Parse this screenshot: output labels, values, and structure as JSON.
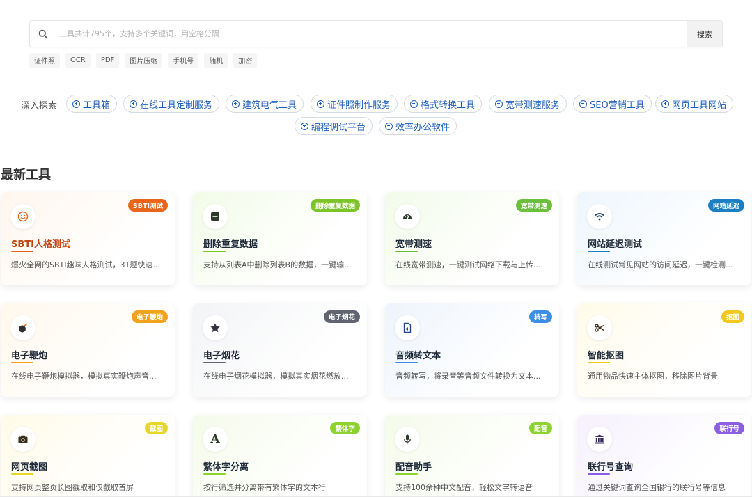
{
  "search": {
    "placeholder": "工具共计795个，支持多个关键词，用空格分隔",
    "button_label": "搜索"
  },
  "tags": [
    "证件照",
    "OCR",
    "PDF",
    "图片压缩",
    "手机号",
    "随机",
    "加密"
  ],
  "explore": {
    "label": "深入探索",
    "chips": [
      "工具箱",
      "在线工具定制服务",
      "建筑电气工具",
      "证件照制作服务",
      "格式转换工具",
      "宽带测速服务",
      "SEO营销工具",
      "网页工具网站",
      "编程调试平台",
      "效率办公软件"
    ]
  },
  "section_title": "最新工具",
  "cards": [
    {
      "title": "SBTI人格测试",
      "badge": "SBTI测试",
      "desc": "爆火全网的SBTI趣味人格测试，31题快速...",
      "icon": "smile-icon",
      "accent": "#e8661c",
      "bg": "#fff6ee"
    },
    {
      "title": "删除重复数据",
      "badge": "删除重复数据",
      "desc": "支持从列表A中删除列表B的数据，一键输...",
      "icon": "minus-square-icon",
      "accent": "#7cc428",
      "bg": "#f3fbe8"
    },
    {
      "title": "宽带测速",
      "badge": "宽带测速",
      "desc": "在线宽带测速，一键测试网络下载与上传...",
      "icon": "speedometer-icon",
      "accent": "#6cbf3a",
      "bg": "#f3fbea"
    },
    {
      "title": "网站延迟测试",
      "badge": "网站延迟",
      "desc": "在线测试常见网站的访问延迟，一键检测...",
      "icon": "wifi-icon",
      "accent": "#1b7fc4",
      "bg": "#eef6fd"
    },
    {
      "title": "电子鞭炮",
      "badge": "电子鞭炮",
      "desc": "在线电子鞭炮模拟器，模拟真实鞭炮声音...",
      "icon": "bomb-icon",
      "accent": "#f2a21c",
      "bg": "#fff8ec"
    },
    {
      "title": "电子烟花",
      "badge": "电子烟花",
      "desc": "在线电子烟花模拟器，模拟真实烟花燃放...",
      "icon": "star-icon",
      "accent": "#5f6470",
      "bg": "#f3f4f6"
    },
    {
      "title": "音频转文本",
      "badge": "转写",
      "desc": "音频转写，将录音等音频文件转换为文本...",
      "icon": "audio-file-icon",
      "accent": "#3d8ee6",
      "bg": "#eef4fc"
    },
    {
      "title": "智能抠图",
      "badge": "抠图",
      "desc": "通用物品快速主体抠图，移除图片背景",
      "icon": "scissors-icon",
      "accent": "#f2c81c",
      "bg": "#fffbea"
    },
    {
      "title": "网页截图",
      "badge": "截图",
      "desc": "支持网页整页长图截取和仅截取首屏",
      "icon": "camera-icon",
      "accent": "#e6d82a",
      "bg": "#fffbe8"
    },
    {
      "title": "繁体字分离",
      "badge": "繁体字",
      "desc": "按行筛选并分离带有繁体字的文本行",
      "icon": "letter-a-icon",
      "accent": "#8cd230",
      "bg": "#f5fbea"
    },
    {
      "title": "配音助手",
      "badge": "配音",
      "desc": "支持100余种中文配音，轻松文字转语音",
      "icon": "microphone-icon",
      "accent": "#8cd230",
      "bg": "#f5fbea"
    },
    {
      "title": "联行号查询",
      "badge": "联行号",
      "desc": "通过关键词查询全国银行的联行号等信息",
      "icon": "bank-icon",
      "accent": "#8b5fe0",
      "bg": "#f6f1fd"
    }
  ]
}
